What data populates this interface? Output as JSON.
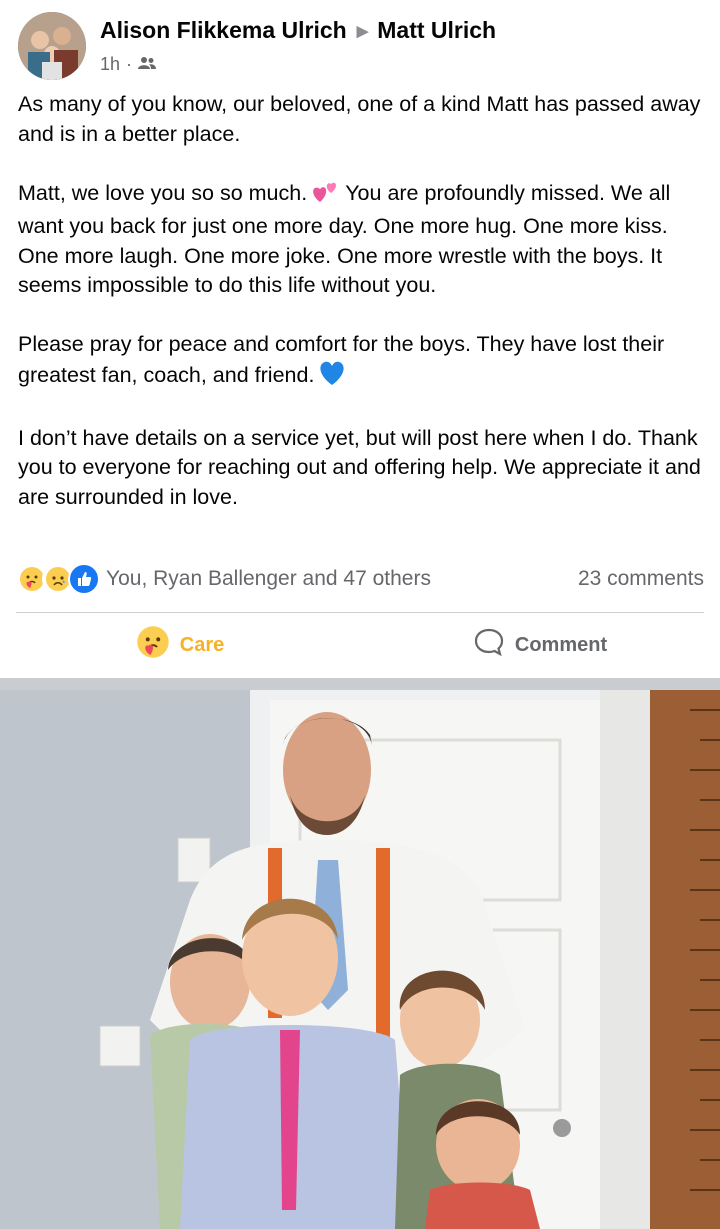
{
  "post": {
    "author": "Alison Flikkema Ulrich",
    "recipient": "Matt Ulrich",
    "time": "1h",
    "separator": "·",
    "paragraphs": {
      "p1": "As many of you know, our beloved, one of a kind Matt has passed away and is in a better place.",
      "p2a": "Matt, we love you so so much.",
      "p2b": "You are profoundly missed. We all want you back for just one more day. One more hug. One more kiss. One more laugh. One more joke. One more wrestle with the boys. It seems impossible to do this life without you.",
      "p3": "Please pray for peace and comfort for the boys. They have lost their greatest fan, coach, and friend.",
      "p4": "I don’t have details on a service yet, but will post here when I do. Thank you to everyone for reaching out and offering help. We appreciate it and are surrounded in love."
    },
    "reactions_text": "You, Ryan Ballenger and 47 others",
    "comments_text": "23 comments",
    "reaction_icons": [
      "care-emoji-icon",
      "sad-emoji-icon",
      "like-icon"
    ],
    "actions": {
      "care_label": "Care",
      "comment_label": "Comment"
    },
    "colors": {
      "care": "#f7b125",
      "like": "#1877f2",
      "secondary_text": "#65676b"
    }
  }
}
